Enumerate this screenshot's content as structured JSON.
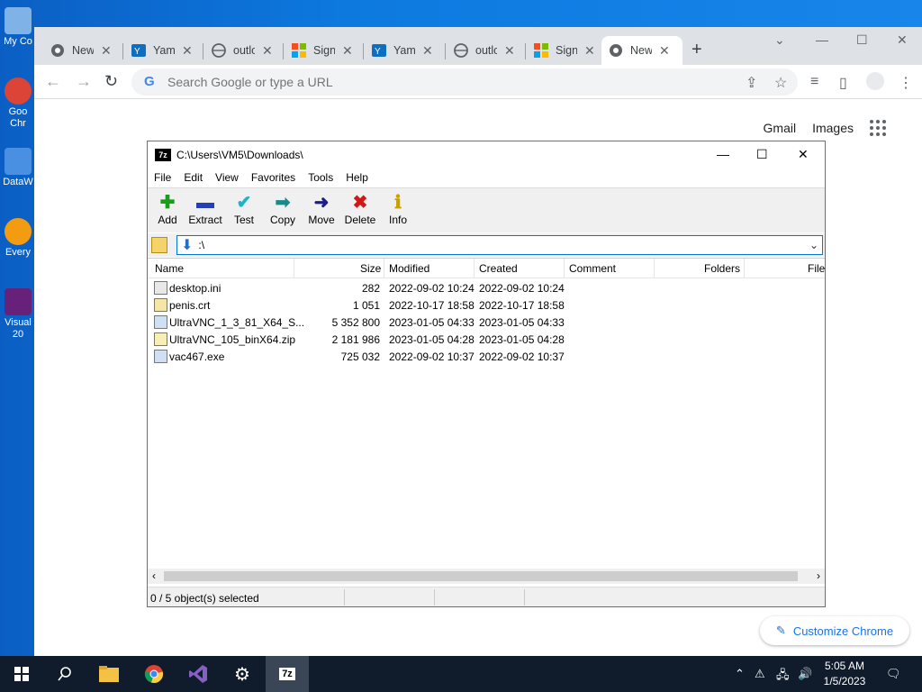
{
  "desktop": {
    "icons": [
      {
        "label": "My Co",
        "color": "#7fb3e8"
      },
      {
        "label": "Goo Chr",
        "color": "#db4437"
      },
      {
        "label": "DataW",
        "color": "#4a90e2"
      },
      {
        "label": "Every",
        "color": "#f39c12"
      },
      {
        "label": "Visual 20",
        "color": "#68217a"
      }
    ]
  },
  "chrome": {
    "tabs": [
      {
        "title": "New",
        "icon": "chrome-icon"
      },
      {
        "title": "Yam",
        "icon": "yammer-icon"
      },
      {
        "title": "outlo",
        "icon": "globe-icon"
      },
      {
        "title": "Sign",
        "icon": "microsoft-icon"
      },
      {
        "title": "Yam",
        "icon": "yammer-icon"
      },
      {
        "title": "outlo",
        "icon": "globe-icon"
      },
      {
        "title": "Sign",
        "icon": "microsoft-icon"
      },
      {
        "title": "New",
        "icon": "chrome-icon"
      }
    ],
    "omnibox_placeholder": "Search Google or type a URL",
    "links": {
      "gmail": "Gmail",
      "images": "Images"
    },
    "customize": "Customize Chrome"
  },
  "sevenzip": {
    "title": "C:\\Users\\VM5\\Downloads\\",
    "logo": "7z",
    "menu": [
      "File",
      "Edit",
      "View",
      "Favorites",
      "Tools",
      "Help"
    ],
    "tools": [
      {
        "label": "Add",
        "icon": "plus-icon",
        "color": "#1a9e1a"
      },
      {
        "label": "Extract",
        "icon": "minus-icon",
        "color": "#2440b3"
      },
      {
        "label": "Test",
        "icon": "check-icon",
        "color": "#19b5c9"
      },
      {
        "label": "Copy",
        "icon": "double-arrow-icon",
        "color": "#198a8a"
      },
      {
        "label": "Move",
        "icon": "arrow-right-icon",
        "color": "#1c1c8a"
      },
      {
        "label": "Delete",
        "icon": "x-icon",
        "color": "#d01818"
      },
      {
        "label": "Info",
        "icon": "info-icon",
        "color": "#c8a000"
      }
    ],
    "address": ":\\",
    "columns": [
      "Name",
      "Size",
      "Modified",
      "Created",
      "Comment",
      "Folders",
      "File"
    ],
    "files": [
      {
        "name": "desktop.ini",
        "size": "282",
        "modified": "2022-09-02 10:24",
        "created": "2022-09-02 10:24",
        "icon": "ini-file-icon"
      },
      {
        "name": "penis.crt",
        "size": "1 051",
        "modified": "2022-10-17 18:58",
        "created": "2022-10-17 18:58",
        "icon": "certificate-icon"
      },
      {
        "name": "UltraVNC_1_3_81_X64_S...",
        "size": "5 352 800",
        "modified": "2023-01-05 04:33",
        "created": "2023-01-05 04:33",
        "icon": "exe-icon"
      },
      {
        "name": "UltraVNC_105_binX64.zip",
        "size": "2 181 986",
        "modified": "2023-01-05 04:28",
        "created": "2023-01-05 04:28",
        "icon": "zip-icon"
      },
      {
        "name": "vac467.exe",
        "size": "725 032",
        "modified": "2022-09-02 10:37",
        "created": "2022-09-02 10:37",
        "icon": "exe-icon"
      }
    ],
    "status": "0 / 5 object(s) selected"
  },
  "taskbar": {
    "time": "5:05 AM",
    "date": "1/5/2023",
    "apps": [
      "start-icon",
      "search-icon",
      "file-explorer-icon",
      "chrome-icon",
      "visual-studio-icon",
      "settings-icon",
      "sevenzip-icon"
    ]
  }
}
